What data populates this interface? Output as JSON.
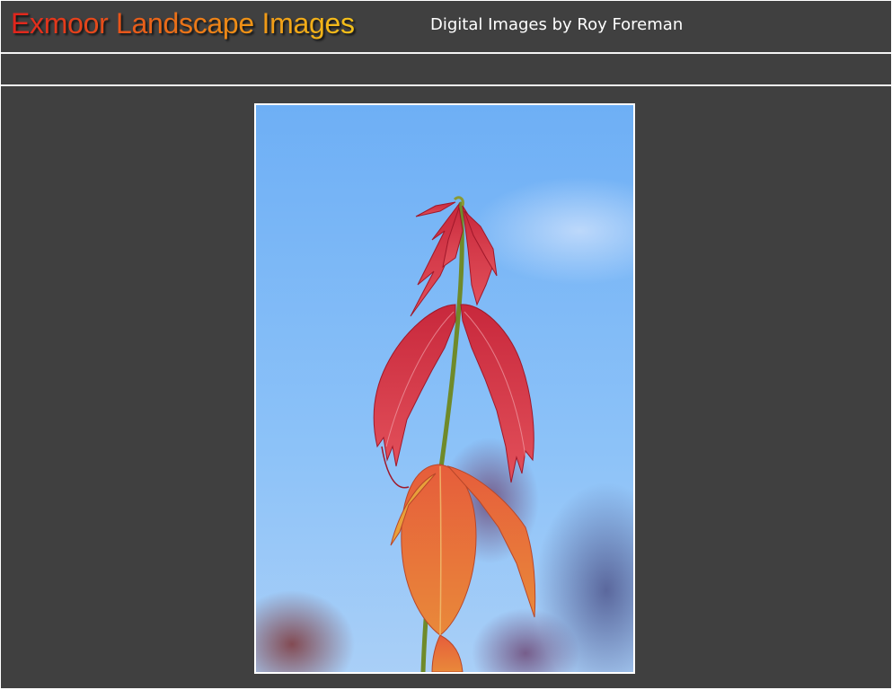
{
  "header": {
    "site_title": "Exmoor Landscape Images",
    "subtitle": "Digital Images by Roy Foreman"
  },
  "photo": {
    "subject": "red-maple-shoot",
    "sky_color": "#7cb8f6",
    "leaf_color": "#d9394a",
    "lower_leaf_color": "#e0703a",
    "stem_color": "#6f8a2a"
  },
  "colors": {
    "page_background": "#404040",
    "rule_color": "#f4f4f4",
    "title_gradient_start": "#e0231c",
    "title_gradient_end": "#f4c21a",
    "subtitle_color": "#ffffff"
  }
}
